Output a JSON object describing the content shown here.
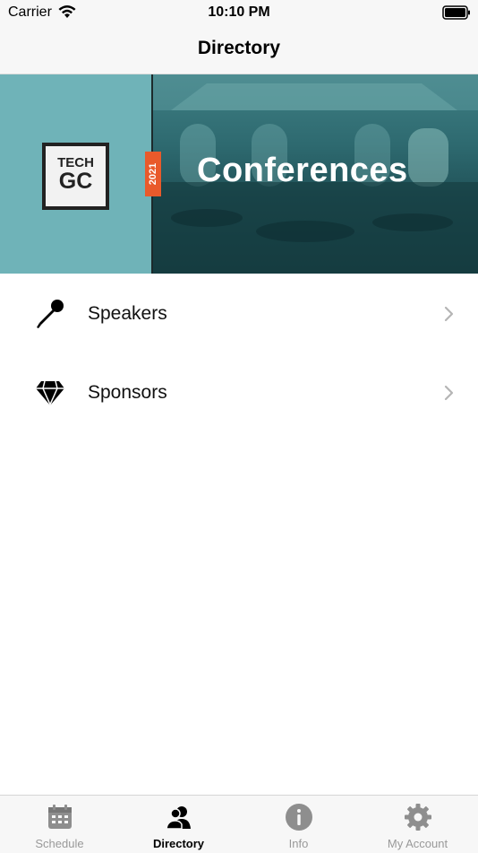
{
  "status_bar": {
    "carrier": "Carrier",
    "time": "10:10 PM"
  },
  "nav": {
    "title": "Directory"
  },
  "banner": {
    "logo_line1": "TECH",
    "logo_line2": "GC",
    "year": "2021",
    "title": "Conferences",
    "colors": {
      "left_panel": "#6fb3b8",
      "badge": "#e95a2b"
    }
  },
  "list": [
    {
      "label": "Speakers",
      "icon": "microphone-icon"
    },
    {
      "label": "Sponsors",
      "icon": "diamond-icon"
    }
  ],
  "tabs": [
    {
      "label": "Schedule",
      "icon": "calendar-icon",
      "active": false
    },
    {
      "label": "Directory",
      "icon": "people-icon",
      "active": true
    },
    {
      "label": "Info",
      "icon": "info-icon",
      "active": false
    },
    {
      "label": "My Account",
      "icon": "gear-icon",
      "active": false
    }
  ]
}
